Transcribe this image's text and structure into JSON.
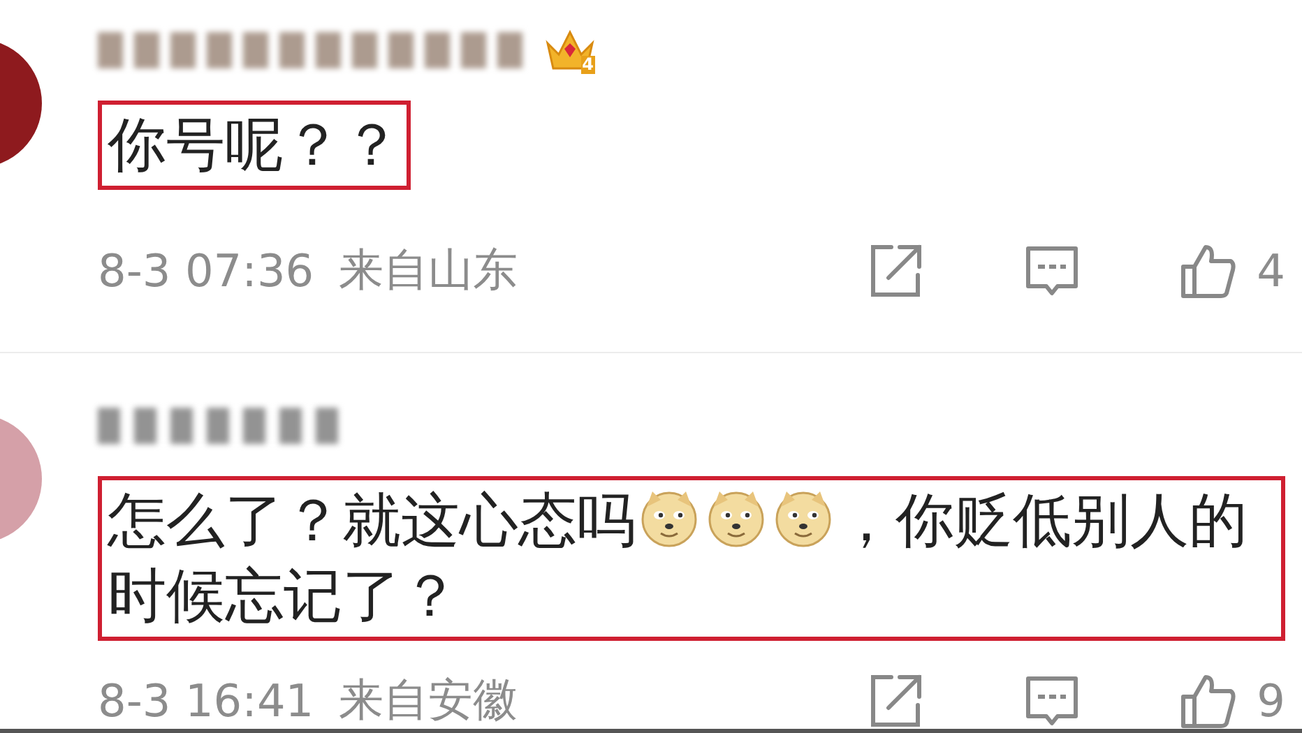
{
  "comments": [
    {
      "name_hidden": true,
      "vip_badge": "4",
      "content": [
        {
          "kind": "text",
          "text": "你号呢？？"
        }
      ],
      "highlighted": true,
      "time": "8-3 07:36",
      "location": "来自山东",
      "likes": "4"
    },
    {
      "name_hidden": true,
      "content": [
        {
          "kind": "text",
          "text": "怎么了？就这心态吗"
        },
        {
          "kind": "emoji"
        },
        {
          "kind": "emoji"
        },
        {
          "kind": "emoji"
        },
        {
          "kind": "text",
          "text": "，你贬低别人的时候忘记了？"
        }
      ],
      "highlighted": true,
      "time": "8-3 16:41",
      "location": "来自安徽",
      "likes": "9"
    }
  ]
}
